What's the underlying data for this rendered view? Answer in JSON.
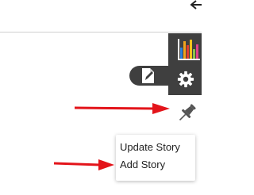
{
  "colors": {
    "toolbar_bg": "#3f3f3f",
    "annotation_arrow": "#e3141a",
    "menu_text": "#222222"
  },
  "toolbar": {
    "back_icon": "arrow-left-icon",
    "chart_icon": "bar-chart-icon",
    "settings_icon": "gear-icon",
    "edit_icon": "edit-document-icon",
    "pin_icon": "pushpin-icon"
  },
  "story_menu": {
    "items": [
      {
        "label": "Update Story"
      },
      {
        "label": "Add Story"
      }
    ]
  }
}
